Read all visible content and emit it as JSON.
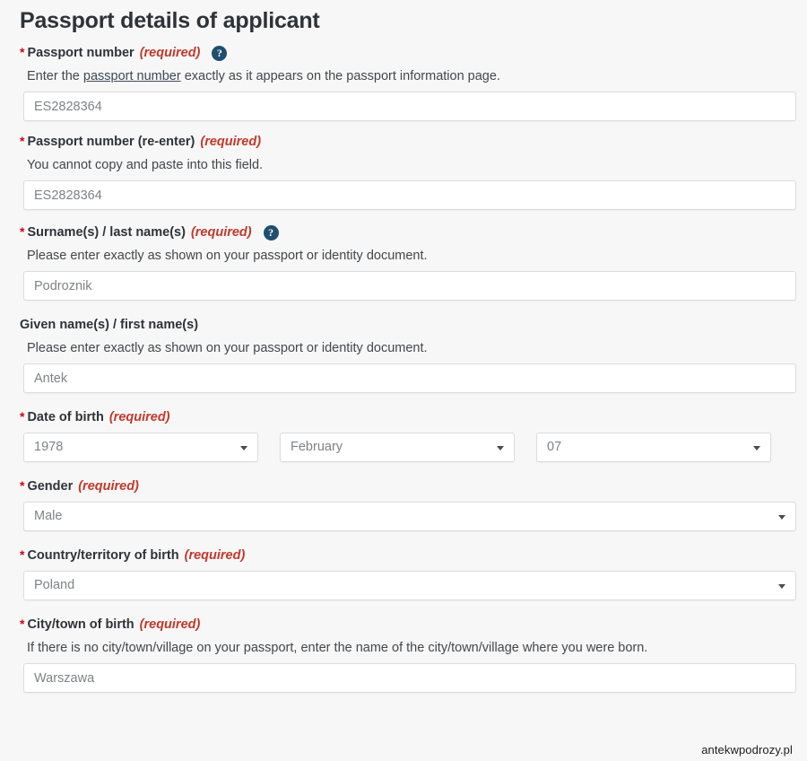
{
  "page": {
    "title": "Passport details of applicant",
    "watermark": "antekwpodrozy.pl",
    "required_tag": "(required)",
    "star": "*",
    "help_glyph": "?"
  },
  "colors": {
    "background": "#f7f7f7",
    "title": "#2d3339",
    "required_red": "#c0392b",
    "star_red": "#d0021b",
    "help_icon_bg": "#1f4e6e",
    "input_border": "#dcdcdc",
    "input_text": "#7d8387",
    "hint_text": "#43474c"
  },
  "fields": {
    "passport_number": {
      "label": "Passport number",
      "required": "(required)",
      "hint_before": "Enter the ",
      "hint_link": "passport number",
      "hint_after": " exactly as it appears on the passport information page.",
      "value": "ES2828364"
    },
    "passport_number_reenter": {
      "label": "Passport number (re-enter)",
      "required": "(required)",
      "hint": "You cannot copy and paste into this field.",
      "value": "ES2828364"
    },
    "surname": {
      "label": "Surname(s) / last name(s)",
      "required": "(required)",
      "hint": "Please enter exactly as shown on your passport or identity document.",
      "value": "Podroznik"
    },
    "given_name": {
      "label": "Given name(s) / first name(s)",
      "required": "",
      "hint": "Please enter exactly as shown on your passport or identity document.",
      "value": "Antek"
    },
    "date_of_birth": {
      "label": "Date of birth",
      "required": "(required)",
      "year": "1978",
      "month": "February",
      "day": "07"
    },
    "gender": {
      "label": "Gender",
      "required": "(required)",
      "value": "Male"
    },
    "country_of_birth": {
      "label": "Country/territory of birth",
      "required": "(required)",
      "value": "Poland"
    },
    "city_of_birth": {
      "label": "City/town of birth",
      "required": "(required)",
      "hint": "If there is no city/town/village on your passport, enter the name of the city/town/village where you were born.",
      "value": "Warszawa"
    }
  }
}
